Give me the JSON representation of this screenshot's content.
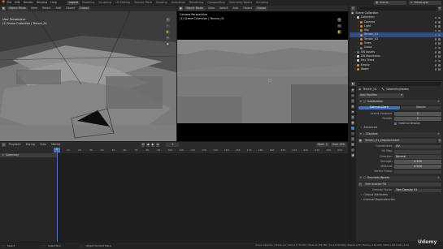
{
  "menu": {
    "items": [
      "File",
      "Edit",
      "Render",
      "Window",
      "Help"
    ],
    "workspaces": [
      "Layout",
      "Modeling",
      "Sculpting",
      "UV Editing",
      "Texture Paint",
      "Shading",
      "Animation",
      "Rendering",
      "Compositing",
      "Geometry Nodes",
      "Scripting"
    ],
    "scene": "Scene",
    "view_layer": "ViewLayer"
  },
  "left_view": {
    "perspective": "User Perspective",
    "collection": "(1) Scene Collection | Terrain_01",
    "header": [
      "Object Mode",
      "View",
      "Select",
      "Add",
      "Object",
      "Global"
    ]
  },
  "right_view": {
    "perspective": "Camera Perspective",
    "collection": "(1) Scene Collection | Terrain_01",
    "header": [
      "Object Mode",
      "View",
      "Select",
      "Add",
      "Object",
      "Global"
    ]
  },
  "timeline": {
    "menus": [
      "Playback",
      "Keying",
      "View",
      "Marker"
    ],
    "frame": "1",
    "start_label": "Start",
    "start": "1",
    "end_label": "End",
    "end": "250",
    "summary": "Summary",
    "ticks": [
      "0",
      "10",
      "20",
      "30",
      "40",
      "50",
      "60",
      "70",
      "80",
      "90",
      "100",
      "110",
      "120",
      "130",
      "140",
      "150",
      "160",
      "170",
      "180",
      "190",
      "200",
      "210",
      "220",
      "230",
      "240",
      "250"
    ]
  },
  "outliner": {
    "title": "Scene Collection",
    "rows": [
      {
        "label": "Collection",
        "indent": 1,
        "color": "#d9d9d9"
      },
      {
        "label": "Camera",
        "indent": 2,
        "color": "#d48b3b"
      },
      {
        "label": "Light",
        "indent": 2,
        "color": "#d48b3b"
      },
      {
        "label": "Sky",
        "indent": 2,
        "color": "#d48b3b"
      },
      {
        "label": "Terrain_01",
        "indent": 2,
        "color": "#d48b3b"
      },
      {
        "label": "Terrain_02",
        "indent": 2,
        "color": "#d48b3b"
      },
      {
        "label": "Trees",
        "indent": 2,
        "color": "#d48b3b"
      },
      {
        "label": "Grass",
        "indent": 2,
        "color": "#777777"
      },
      {
        "label": "GN Assets",
        "indent": 1,
        "color": "#777777"
      },
      {
        "label": "GN Mountains",
        "indent": 1,
        "color": "#d9d9d9"
      },
      {
        "label": "Hay Trees",
        "indent": 1,
        "color": "#d9d9d9"
      },
      {
        "label": "Empty",
        "indent": 1,
        "color": "#d48b3b"
      },
      {
        "label": "Water",
        "indent": 1,
        "color": "#d48b3b"
      }
    ]
  },
  "properties": {
    "object": "Terrain_01",
    "modifier_tab": "GeometryNodes",
    "add_modifier": "Add Modifier",
    "subdivision": {
      "name": "Subdivision",
      "tabs": [
        "Catmull-Clark",
        "Simple"
      ],
      "rows": [
        {
          "label": "Levels Viewport",
          "value": "2"
        },
        {
          "label": "Render",
          "value": "2"
        }
      ],
      "optimal": "Optimal Display",
      "advanced": "Advanced"
    },
    "displace": {
      "name": "Displace",
      "texture": "Terrain_01_Displacement",
      "rows": [
        {
          "label": "Coordinates",
          "value": "UV"
        },
        {
          "label": "UV Map",
          "value": ""
        },
        {
          "label": "Direction",
          "value": "Normal"
        },
        {
          "label": "Strength",
          "value": "0.350"
        },
        {
          "label": "Midlevel",
          "value": "0.500"
        },
        {
          "label": "Vertex Group",
          "value": ""
        }
      ]
    },
    "geonodes": {
      "name": "GeometryNodes",
      "tree": "Tree Scatter FN",
      "rows": [
        {
          "label": "Density Factor",
          "value": "Tree Density 01"
        }
      ],
      "sections": [
        "Output Attributes",
        "Internal Dependencies"
      ]
    }
  },
  "status": {
    "left": "Select",
    "mid1": "Select Box",
    "mid2": "Object Context Menu",
    "right": "Scene Collection | Terrain_01 | Verts 11,776,300 | Faces 11,759,280 | Tris 23,518,560 | Objects 1/10 | Memory 3.61 GiB | VRAM 1.2/8.0 GiB | 3.6.0"
  },
  "watermark": "Udemy",
  "colors": {
    "accent": "#4772b3",
    "orange": "#d48b3b"
  }
}
